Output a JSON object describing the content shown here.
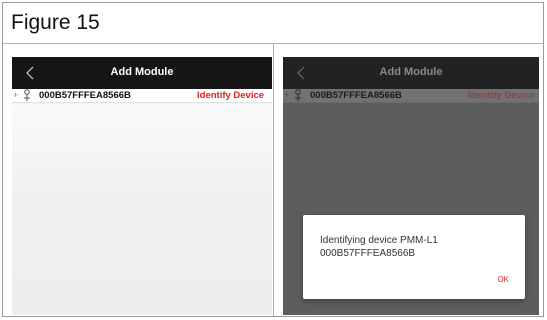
{
  "figure": {
    "title": "Figure 15"
  },
  "left_screen": {
    "appbar": {
      "title": "Add Module",
      "back_icon": "chevron-left-icon"
    },
    "device_row": {
      "expand_symbol": "+",
      "node_icon": "device-node-icon",
      "address": "000B57FFFEA8566B",
      "action_label": "Identify Device",
      "action_color": "#e02020"
    }
  },
  "right_screen": {
    "appbar": {
      "title": "Add Module",
      "back_icon": "chevron-left-icon"
    },
    "device_row": {
      "expand_symbol": "+",
      "node_icon": "device-node-icon",
      "address": "000B57FFFEA8566B",
      "action_label": "Identify Device"
    },
    "dialog": {
      "line1": "Identifying device PMM-L1",
      "line2": "000B57FFFEA8566B",
      "ok_label": "OK",
      "ok_color": "#d42a2a"
    }
  }
}
